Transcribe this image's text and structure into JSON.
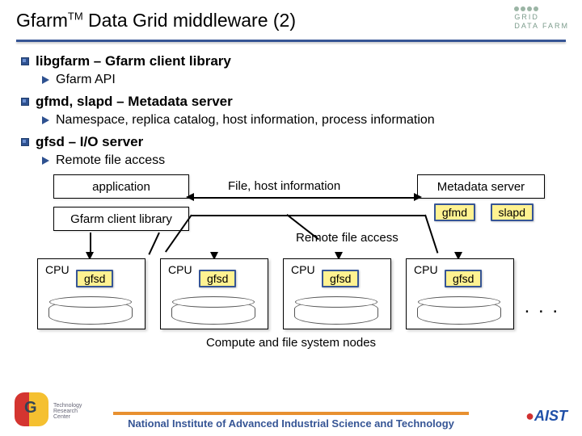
{
  "header": {
    "title_pre": "Gfarm",
    "title_sup": "TM",
    "title_post": " Data Grid middleware (2)",
    "logo_lines": [
      "GRID",
      "DATA FARM"
    ]
  },
  "bullets": [
    {
      "text": "libgfarm – Gfarm client library",
      "sub": "Gfarm API"
    },
    {
      "text": "gfmd, slapd – Metadata server",
      "sub": "Namespace, replica catalog, host information, process information"
    },
    {
      "text": "gfsd – I/O server",
      "sub": "Remote file access"
    }
  ],
  "diagram": {
    "application": "application",
    "client_library": "Gfarm client library",
    "metadata_server": "Metadata server",
    "gfmd": "gfmd",
    "slapd": "slapd",
    "file_host_info": "File, host information",
    "remote_file_access": "Remote file access",
    "cpu": "CPU",
    "gfsd": "gfsd",
    "dots": ". . .",
    "caption": "Compute and file system nodes"
  },
  "footer": {
    "text": "National Institute of Advanced Industrial Science and Technology",
    "tech": "Technology\nResearch\nCenter",
    "aist": "AIST"
  }
}
